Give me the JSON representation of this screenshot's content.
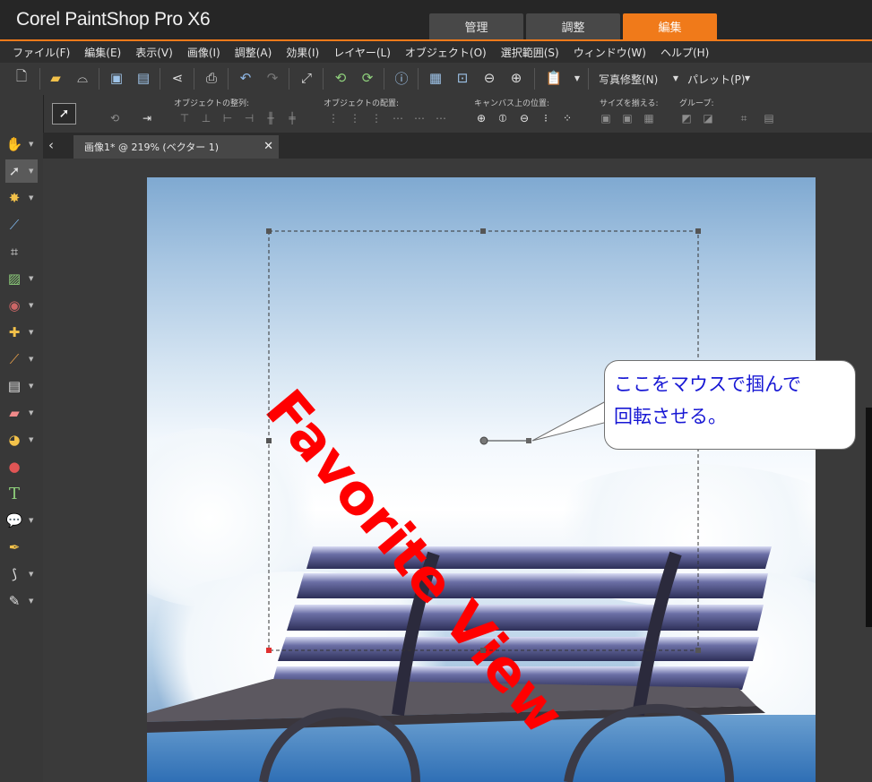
{
  "app": {
    "title": "Corel PaintShop Pro X6"
  },
  "workspace_tabs": [
    {
      "label": "管理",
      "active": false
    },
    {
      "label": "調整",
      "active": false
    },
    {
      "label": "編集",
      "active": true
    }
  ],
  "menu": [
    "ファイル(F)",
    "編集(E)",
    "表示(V)",
    "画像(I)",
    "調整(A)",
    "効果(I)",
    "レイヤー(L)",
    "オブジェクト(O)",
    "選択範囲(S)",
    "ウィンドウ(W)",
    "ヘルプ(H)"
  ],
  "toolbar": {
    "photo_fix_label": "写真修整(N)",
    "palette_label": "パレット(P)"
  },
  "tool_options": {
    "group_labels": [
      "オブジェクトの整列:",
      "オブジェクトの配置:",
      "キャンバス上の位置:",
      "サイズを揃える:",
      "グループ:"
    ]
  },
  "document": {
    "tab_title": "画像1* @ 219% (ベクター 1)"
  },
  "canvas": {
    "vector_text": "Favorite View"
  },
  "callout": {
    "line1": "ここをマウスで掴んで",
    "line2": "回転させる。"
  },
  "colors": {
    "accent": "#f07a1a",
    "vector_text": "#ff0000",
    "callout_text": "#1717d4"
  }
}
